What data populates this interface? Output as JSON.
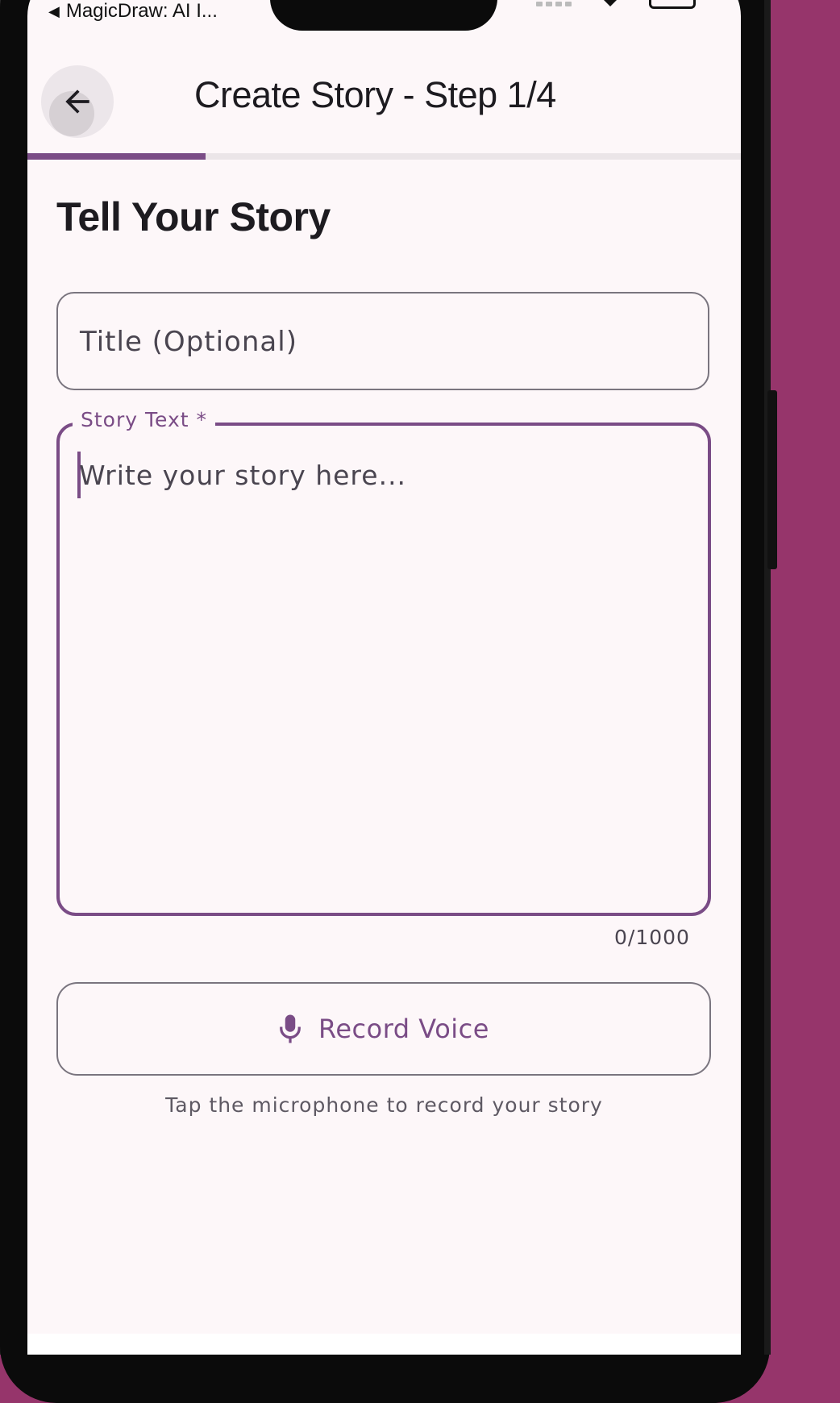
{
  "status_bar": {
    "back_arrow": "◀",
    "back_app_label": "MagicDraw: AI I..."
  },
  "app_bar": {
    "back_icon": "arrow-left-icon",
    "title": "Create Story - Step 1/4"
  },
  "progress": {
    "current_step": 1,
    "total_steps": 4,
    "fraction": 0.25,
    "color": "#7a4c86"
  },
  "form": {
    "heading": "Tell Your Story",
    "title_field": {
      "placeholder": "Title (Optional)",
      "value": ""
    },
    "story_field": {
      "label": "Story Text *",
      "placeholder": "Write your story here...",
      "value": "",
      "counter": "0/1000"
    },
    "record_button": {
      "icon": "microphone-icon",
      "label": "Record Voice"
    },
    "hint": "Tap the microphone to record your story"
  },
  "colors": {
    "accent": "#7a4c86",
    "background": "#fdf7f9",
    "outside_background": "#96356b"
  }
}
